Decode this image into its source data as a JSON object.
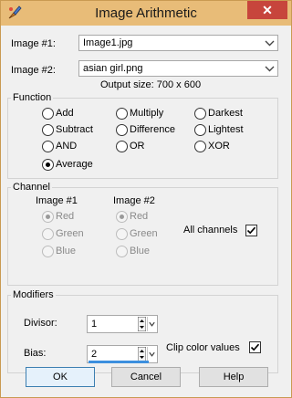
{
  "window": {
    "title": "Image Arithmetic",
    "close_glyph": "✕"
  },
  "images": {
    "image1_label": "Image #1:",
    "image1_value": "Image1.jpg",
    "image2_label": "Image #2:",
    "image2_value": "asian girl.png",
    "output_size": "Output size: 700 x 600"
  },
  "function_group": {
    "title": "Function",
    "options": [
      {
        "label": "Add",
        "checked": false
      },
      {
        "label": "Multiply",
        "checked": false
      },
      {
        "label": "Darkest",
        "checked": false
      },
      {
        "label": "Subtract",
        "checked": false
      },
      {
        "label": "Difference",
        "checked": false
      },
      {
        "label": "Lightest",
        "checked": false
      },
      {
        "label": "AND",
        "checked": false
      },
      {
        "label": "OR",
        "checked": false
      },
      {
        "label": "XOR",
        "checked": false
      },
      {
        "label": "Average",
        "checked": true
      }
    ]
  },
  "channel_group": {
    "title": "Channel",
    "image1_header": "Image #1",
    "image2_header": "Image #2",
    "image1_channels": [
      "Red",
      "Green",
      "Blue"
    ],
    "image2_channels": [
      "Red",
      "Green",
      "Blue"
    ],
    "all_channels_label": "All channels",
    "all_channels_checked": true
  },
  "modifiers_group": {
    "title": "Modifiers",
    "divisor_label": "Divisor:",
    "divisor_value": "1",
    "bias_label": "Bias:",
    "bias_value": "2",
    "clip_label": "Clip color values",
    "clip_checked": true
  },
  "buttons": {
    "ok": "OK",
    "cancel": "Cancel",
    "help": "Help"
  },
  "colors": {
    "titlebar": "#e8bc78",
    "close": "#c7453c",
    "accent": "#3c7fb1"
  }
}
